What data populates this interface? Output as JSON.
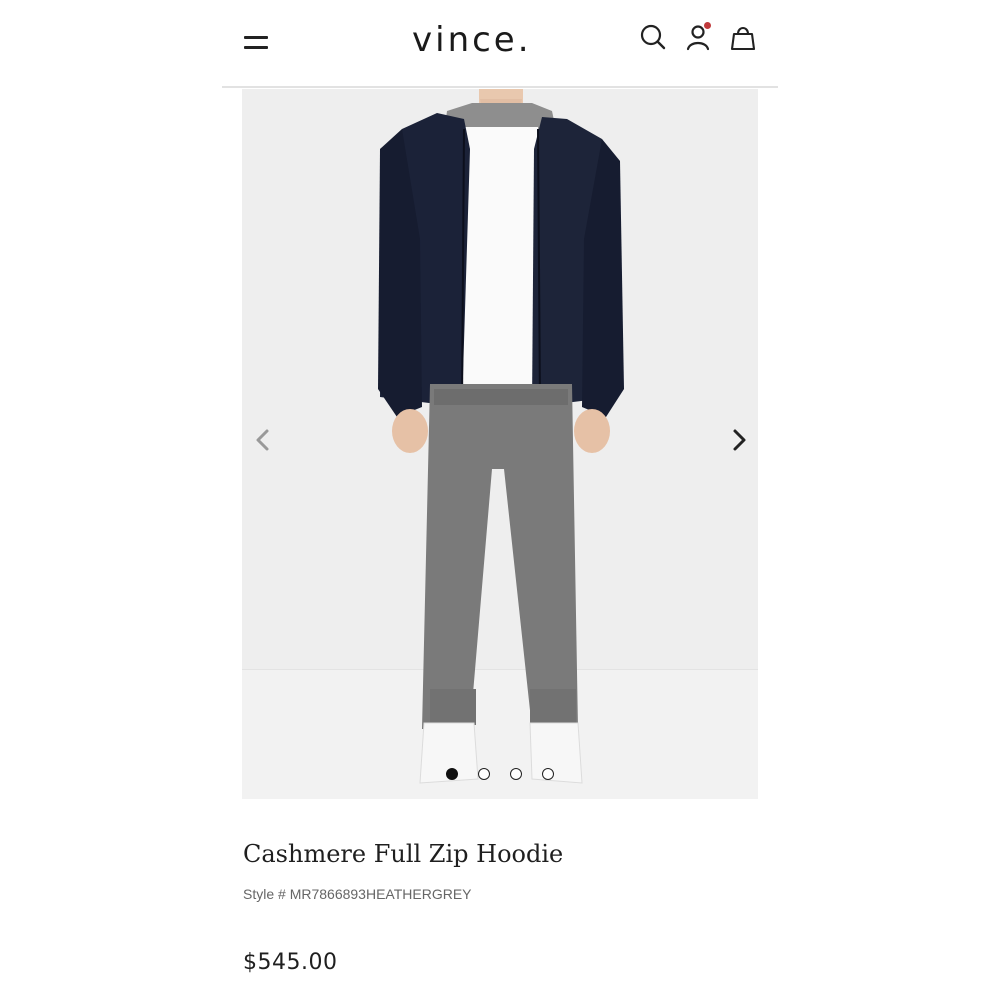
{
  "header": {
    "logo": "vince.",
    "menu_icon": "hamburger-menu-icon",
    "search_icon": "search-icon",
    "account_icon": "account-icon",
    "bag_icon": "shopping-bag-icon",
    "notification_color": "#c0393b"
  },
  "gallery": {
    "prev_icon": "chevron-left-icon",
    "next_icon": "chevron-right-icon",
    "image_count": 4,
    "active_index": 0,
    "image_alt": "Model wearing navy cashmere full zip hoodie with white t-shirt and grey joggers"
  },
  "product": {
    "title": "Cashmere Full Zip Hoodie",
    "style": "Style # MR7866893HEATHERGREY",
    "price": "$545.00"
  },
  "colors": {
    "hoodie": "#1b2238",
    "pants": "#7a7a7a",
    "background": "#eeeeee"
  }
}
